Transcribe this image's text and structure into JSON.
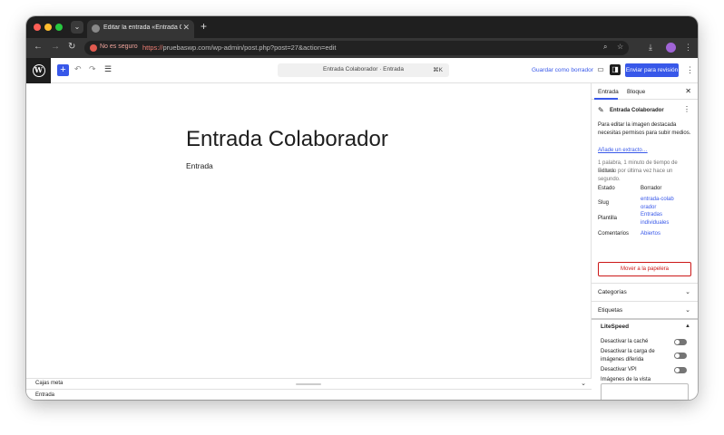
{
  "browser": {
    "tab_title": "Editar la entrada «Entrada Colaborador» ‹ Prueba WP — WordPress",
    "security_label": "No es seguro",
    "url_scheme": "https://",
    "url_rest": "pruebaswp.com/wp-admin/post.php?post=27&action=edit",
    "new_tab": "+"
  },
  "toolbar": {
    "command_title": "Entrada Colaborador · Entrada",
    "command_shortcut": "⌘K",
    "save_draft": "Guardar como borrador",
    "submit_review": "Enviar para revisión"
  },
  "post": {
    "title": "Entrada Colaborador",
    "body": "Entrada"
  },
  "footer": {
    "meta_boxes": "Cajas meta",
    "breadcrumb": "Entrada"
  },
  "sidebar": {
    "tab_post": "Entrada",
    "tab_block": "Bloque",
    "post_name": "Entrada Colaborador",
    "featured_note": "Para editar la imagen destacada necesitas permisos para subir medios.",
    "excerpt_link": "Añade un extracto…",
    "reading_info": "1 palabra, 1 minuto de tiempo de lectura.",
    "edited_info": "Editado por última vez hace un segundo.",
    "status_label": "Estado",
    "status_value": "Borrador",
    "slug_label": "Slug",
    "slug_value": "entrada-colaborador",
    "template_label": "Plantilla",
    "template_value": "Entradas individuales",
    "comments_label": "Comentarios",
    "comments_value": "Abiertos",
    "trash_button": "Mover a la papelera",
    "categories": "Categorías",
    "tags": "Etiquetas",
    "litespeed": {
      "title": "LiteSpeed",
      "disable_cache": "Desactivar la caché",
      "disable_lazy": "Desactivar la carga de imágenes diferida",
      "disable_vpi": "Desactivar VPI",
      "viewport_images": "Imágenes de la vista"
    }
  },
  "colors": {
    "accent": "#3858e9",
    "danger": "#cc1818",
    "browser_chrome": "#1f1f1f"
  }
}
